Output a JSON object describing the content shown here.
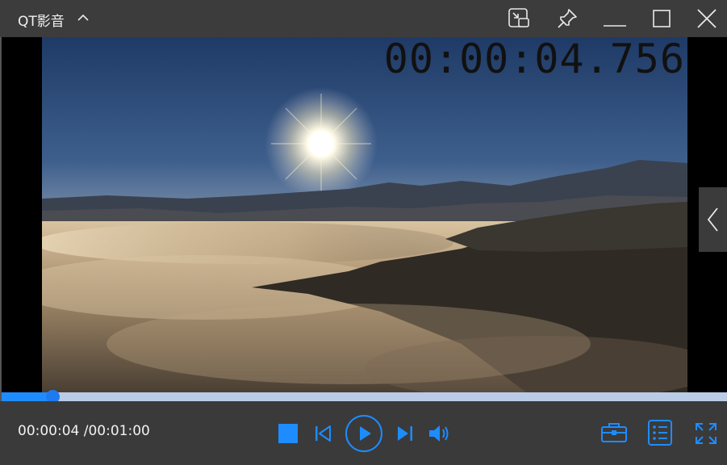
{
  "window": {
    "title": "QT影音",
    "accent": "#1e8cff"
  },
  "titlebar": {
    "buttons": [
      "picture-in-picture-icon",
      "pin-icon",
      "minimize-icon",
      "maximize-icon",
      "close-icon"
    ]
  },
  "video": {
    "timecode": "00:00:04.756"
  },
  "playback": {
    "current_time": "00:00:04",
    "total_time": " /00:01:00",
    "progress": 0.07
  },
  "controls": {
    "buttons": [
      "stop-icon",
      "previous-icon",
      "play-icon",
      "next-icon",
      "volume-icon",
      "toolbox-icon",
      "playlist-icon",
      "fullscreen-icon"
    ]
  }
}
